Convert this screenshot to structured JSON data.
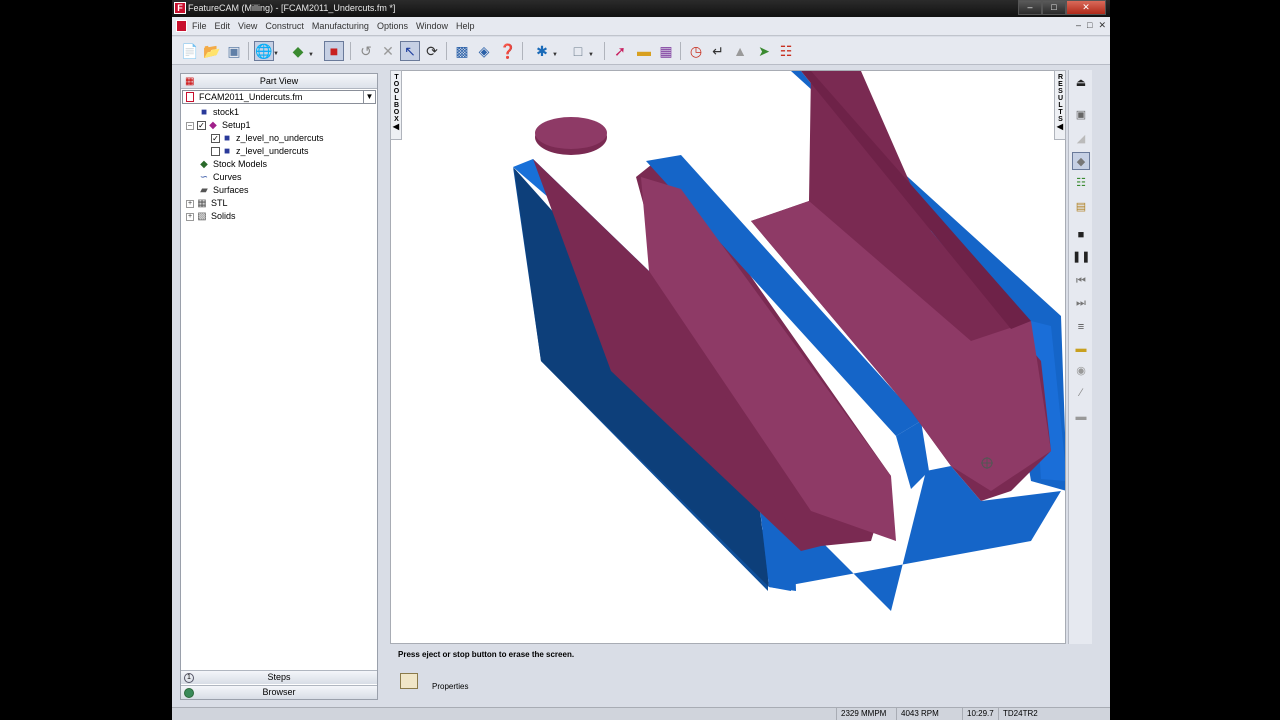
{
  "window": {
    "title": "FeatureCAM (Milling) - [FCAM2011_Undercuts.fm *]",
    "app_icon": "F",
    "buttons": [
      "–",
      "□",
      "✕"
    ]
  },
  "menubar": {
    "items": [
      "File",
      "Edit",
      "View",
      "Construct",
      "Manufacturing",
      "Options",
      "Window",
      "Help"
    ],
    "mdi_buttons": [
      "–",
      "□",
      "✕"
    ]
  },
  "toolbar": {
    "icons": [
      "new-file-icon",
      "open-folder-icon",
      "save-icon",
      "wireframe-view-icon",
      "shade-icon",
      "stock-icon",
      "undo-icon",
      "delete-icon",
      "select-arrow-icon",
      "rotate-icon",
      "wizard-icon",
      "import-icon",
      "help-icon",
      "snap-icon",
      "box-icon",
      "curve-icon",
      "surface-icon",
      "solid-icon",
      "measure-icon",
      "simulate-icon",
      "eraser-icon",
      "toolpath-icon",
      "nc-code-icon"
    ]
  },
  "left_panel": {
    "header": "Part View",
    "file": "FCAM2011_Undercuts.fm",
    "tree": [
      {
        "label": "stock1",
        "depth": 1
      },
      {
        "label": "Setup1",
        "depth": 1
      },
      {
        "label": "z_level_no_undercuts",
        "depth": 2
      },
      {
        "label": "z_level_undercuts",
        "depth": 2
      },
      {
        "label": "Stock Models",
        "depth": 1
      },
      {
        "label": "Curves",
        "depth": 1
      },
      {
        "label": "Surfaces",
        "depth": 1
      },
      {
        "label": "STL",
        "depth": 1
      },
      {
        "label": "Solids",
        "depth": 1
      }
    ],
    "tree_checks": [
      "✓",
      "✓",
      ""
    ],
    "tabs": {
      "steps": "Steps",
      "browser": "Browser"
    }
  },
  "toolbox_label": "TOOLBOX",
  "results_label": "RESULTS",
  "status": {
    "message": "Press eject or stop button to erase the screen.",
    "properties_label": "Properties"
  },
  "statusbar": {
    "feed": "2329 MMPM",
    "speed": "4043 RPM",
    "time": "10:29.7",
    "tool": "TD24TR2"
  },
  "colors": {
    "stock_blue": "#1565c8",
    "stock_blue_dark": "#0d3f7a",
    "part_maroon": "#7a2a52",
    "part_maroon_light": "#8e3a66"
  }
}
